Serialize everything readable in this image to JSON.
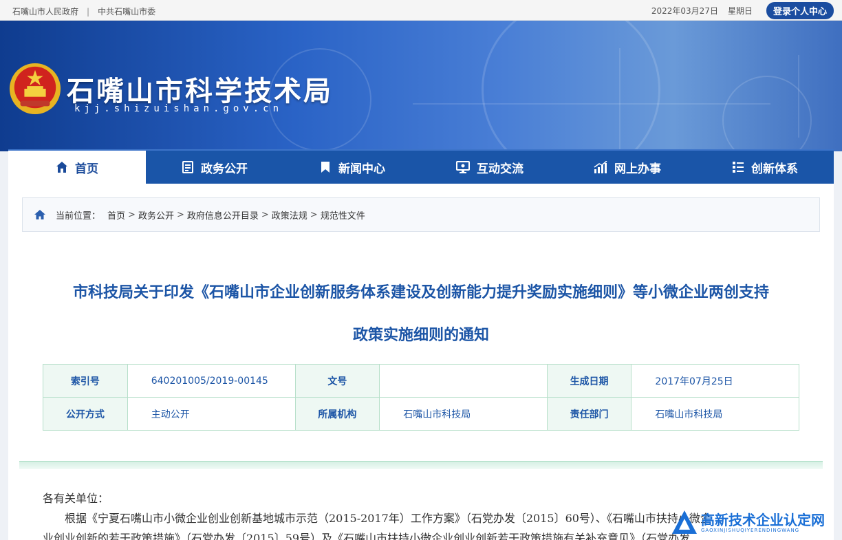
{
  "topbar": {
    "link_gov": "石嘴山市人民政府",
    "separator": "|",
    "link_party": "中共石嘴山市委",
    "date": "2022年03月27日",
    "weekday": "星期日",
    "login_label": "登录个人中心"
  },
  "header": {
    "site_title": "石嘴山市科学技术局",
    "site_domain": "kjj.shizuishan.gov.cn",
    "emblem_icon": "national-emblem-icon"
  },
  "nav": {
    "items": [
      {
        "label": "首页",
        "icon": "home-icon",
        "active": true
      },
      {
        "label": "政务公开",
        "icon": "document-icon"
      },
      {
        "label": "新闻中心",
        "icon": "bookmark-icon"
      },
      {
        "label": "互动交流",
        "icon": "monitor-icon"
      },
      {
        "label": "网上办事",
        "icon": "bar-chart-icon"
      },
      {
        "label": "创新体系",
        "icon": "list-icon"
      }
    ]
  },
  "breadcrumb": {
    "prefix": "当前位置：",
    "items": [
      "首页",
      "政务公开",
      "政府信息公开目录",
      "政策法规",
      "规范性文件"
    ],
    "arrow": ">"
  },
  "document": {
    "title_line1": "市科技局关于印发《石嘴山市企业创新服务体系建设及创新能力提升奖励实施细则》等小微企业两创支持",
    "title_line2": "政策实施细则的通知",
    "meta": {
      "index_label": "索引号",
      "index_value": "640201005/2019-00145",
      "doc_no_label": "文号",
      "doc_no_value": "",
      "date_label": "生成日期",
      "date_value": "2017年07月25日",
      "open_mode_label": "公开方式",
      "open_mode_value": "主动公开",
      "org_label": "所属机构",
      "org_value": "石嘴山市科技局",
      "dept_label": "责任部门",
      "dept_value": "石嘴山市科技局"
    },
    "greeting": "各有关单位：",
    "para1": "根据《宁夏石嘴山市小微企业创业创新基地城市示范（2015-2017年）工作方案》（石党办发〔2015〕60号）、《石嘴山市扶持小微企",
    "para2": "业创业创新的若干政策措施》（石党办发〔2015〕59号）及《石嘴山市扶持小微企业创业创新若干政策措施有关补充意见》（石党办发"
  },
  "watermark": {
    "main": "高新技术企业认定网",
    "sub": "GAOXINJISHUQIYERENDINGWANG"
  },
  "colors": {
    "nav_blue": "#1a55a8",
    "title_blue": "#1c55a6",
    "table_border": "#b6dfc9"
  }
}
